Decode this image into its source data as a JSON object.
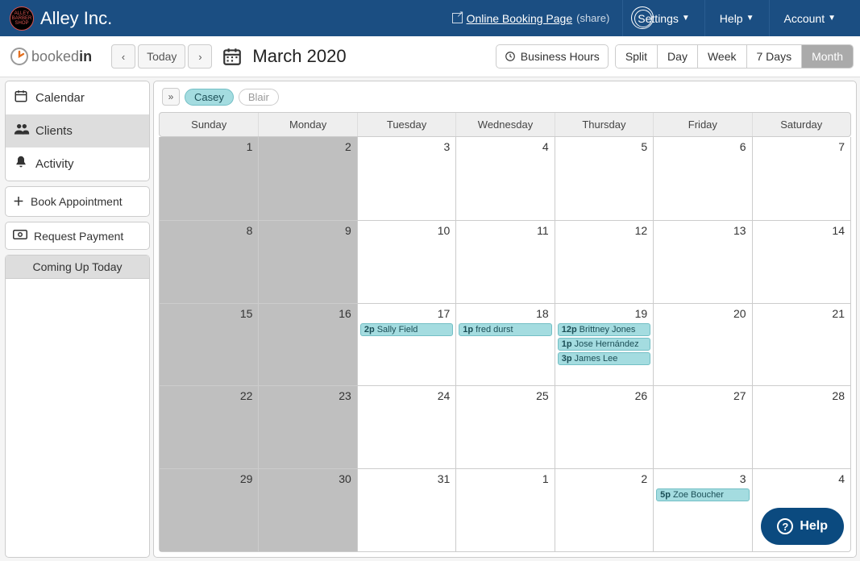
{
  "header": {
    "company": "Alley Inc.",
    "logo_text": "ALLEY BARBER SHOP",
    "online_booking": "Online Booking Page",
    "share": "(share)",
    "menu": {
      "settings": "Settings",
      "help": "Help",
      "account": "Account"
    }
  },
  "brand": {
    "pre": "booked",
    "post": "in"
  },
  "toolbar": {
    "today": "Today",
    "title": "March 2020",
    "business_hours": "Business Hours",
    "views": [
      "Split",
      "Day",
      "Week",
      "7 Days",
      "Month"
    ],
    "active_view": "Month"
  },
  "sidebar": {
    "nav": [
      {
        "icon": "calendar",
        "label": "Calendar"
      },
      {
        "icon": "clients",
        "label": "Clients"
      },
      {
        "icon": "bell",
        "label": "Activity"
      }
    ],
    "active_nav": "Clients",
    "book_btn": "Book Appointment",
    "pay_btn": "Request Payment",
    "today_header": "Coming Up Today"
  },
  "filters": {
    "staff": [
      "Casey",
      "Blair"
    ],
    "active": "Casey"
  },
  "calendar": {
    "day_headers": [
      "Sunday",
      "Monday",
      "Tuesday",
      "Wednesday",
      "Thursday",
      "Friday",
      "Saturday"
    ],
    "weeks": [
      [
        {
          "n": "1",
          "o": true
        },
        {
          "n": "2",
          "o": true
        },
        {
          "n": "3"
        },
        {
          "n": "4"
        },
        {
          "n": "5"
        },
        {
          "n": "6"
        },
        {
          "n": "7"
        }
      ],
      [
        {
          "n": "8",
          "o": true
        },
        {
          "n": "9",
          "o": true
        },
        {
          "n": "10"
        },
        {
          "n": "11"
        },
        {
          "n": "12"
        },
        {
          "n": "13"
        },
        {
          "n": "14"
        }
      ],
      [
        {
          "n": "15",
          "o": true
        },
        {
          "n": "16",
          "o": true
        },
        {
          "n": "17",
          "e": [
            {
              "t": "2p",
              "x": "Sally Field"
            }
          ]
        },
        {
          "n": "18",
          "e": [
            {
              "t": "1p",
              "x": "fred durst"
            }
          ]
        },
        {
          "n": "19",
          "e": [
            {
              "t": "12p",
              "x": "Brittney Jones"
            },
            {
              "t": "1p",
              "x": "Jose Hernández"
            },
            {
              "t": "3p",
              "x": "James Lee"
            }
          ]
        },
        {
          "n": "20"
        },
        {
          "n": "21"
        }
      ],
      [
        {
          "n": "22",
          "o": true
        },
        {
          "n": "23",
          "o": true
        },
        {
          "n": "24"
        },
        {
          "n": "25"
        },
        {
          "n": "26"
        },
        {
          "n": "27"
        },
        {
          "n": "28"
        }
      ],
      [
        {
          "n": "29",
          "o": true
        },
        {
          "n": "30",
          "o": true
        },
        {
          "n": "31"
        },
        {
          "n": "1"
        },
        {
          "n": "2"
        },
        {
          "n": "3",
          "e": [
            {
              "t": "5p",
              "x": "Zoe Boucher"
            }
          ]
        },
        {
          "n": "4"
        }
      ],
      [
        {
          "n": "",
          "blank": true
        },
        {
          "n": "",
          "blank": true
        },
        {
          "n": "",
          "blank": true
        },
        {
          "n": "",
          "blank": true
        },
        {
          "n": "",
          "blank": true
        },
        {
          "n": "",
          "blank": true
        },
        {
          "n": "",
          "blank": true
        }
      ]
    ]
  },
  "fab": "Help"
}
